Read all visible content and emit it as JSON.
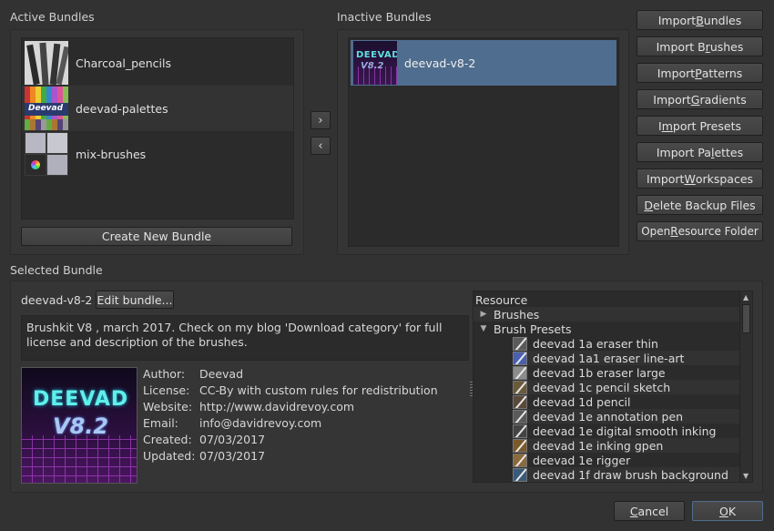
{
  "active": {
    "label": "Active Bundles",
    "bundles": [
      {
        "name": "Charcoal_pencils",
        "thumb": "charcoal-pencils-thumbnail"
      },
      {
        "name": "deevad-palettes",
        "thumb": "deevad-palettes-thumbnail"
      },
      {
        "name": "mix-brushes",
        "thumb": "mix-brushes-thumbnail"
      }
    ],
    "create_button": "Create New Bundle"
  },
  "inactive": {
    "label": "Inactive Bundles",
    "bundles": [
      {
        "name": "deevad-v8-2",
        "thumb": "deevad-v8-2-thumbnail"
      }
    ]
  },
  "transfer": {
    "right_icon": "chevron-right-icon",
    "left_icon": "chevron-left-icon",
    "right_glyph": "›",
    "left_glyph": "‹"
  },
  "actions": [
    {
      "pre": "Import ",
      "key": "B",
      "post": "undles"
    },
    {
      "pre": "Import B",
      "key": "r",
      "post": "ushes"
    },
    {
      "pre": "Import ",
      "key": "P",
      "post": "atterns"
    },
    {
      "pre": "Import ",
      "key": "G",
      "post": "radients"
    },
    {
      "pre": "I",
      "key": "m",
      "post": "port Presets"
    },
    {
      "pre": "Import Pa",
      "key": "l",
      "post": "ettes"
    },
    {
      "pre": "Import ",
      "key": "W",
      "post": "orkspaces"
    },
    {
      "pre": "",
      "key": "D",
      "post": "elete Backup Files"
    },
    {
      "pre": "Open ",
      "key": "R",
      "post": "esource Folder"
    }
  ],
  "selected": {
    "label": "Selected Bundle",
    "name": "deevad-v8-2",
    "edit_button": "Edit bundle...",
    "description": "Brushkit V8 , march 2017. Check on my blog 'Download category' for full license and description of the brushes.",
    "preview_line1": "DEEVAD",
    "preview_line2": "V8.2",
    "meta": [
      {
        "key": "Author:",
        "value": "Deevad"
      },
      {
        "key": "License:",
        "value": "CC-By with custom rules for redistribution"
      },
      {
        "key": "Website:",
        "value": "http://www.davidrevoy.com"
      },
      {
        "key": "Email:",
        "value": "info@davidrevoy.com"
      },
      {
        "key": "Created:",
        "value": "07/03/2017"
      },
      {
        "key": "Updated:",
        "value": "07/03/2017"
      }
    ]
  },
  "resource_tree": {
    "header": "Resource",
    "groups": [
      {
        "name": "Brushes",
        "expanded": false
      },
      {
        "name": "Brush Presets",
        "expanded": true
      }
    ],
    "presets": [
      "deevad 1a eraser thin",
      "deevad 1a1 eraser line-art",
      "deevad 1b eraser large",
      "deevad 1c pencil sketch",
      "deevad 1d pencil",
      "deevad 1e annotation pen",
      "deevad 1e digital smooth inking",
      "deevad 1e inking gpen",
      "deevad 1e rigger",
      "deevad 1f draw brush background"
    ]
  },
  "footer": {
    "cancel": {
      "pre": "",
      "key": "C",
      "post": "ancel"
    },
    "ok": {
      "pre": "",
      "key": "O",
      "post": "K"
    }
  },
  "colors": {
    "selection": "#4f6d8e",
    "background": "#323232",
    "list": "#2b2b2b"
  }
}
